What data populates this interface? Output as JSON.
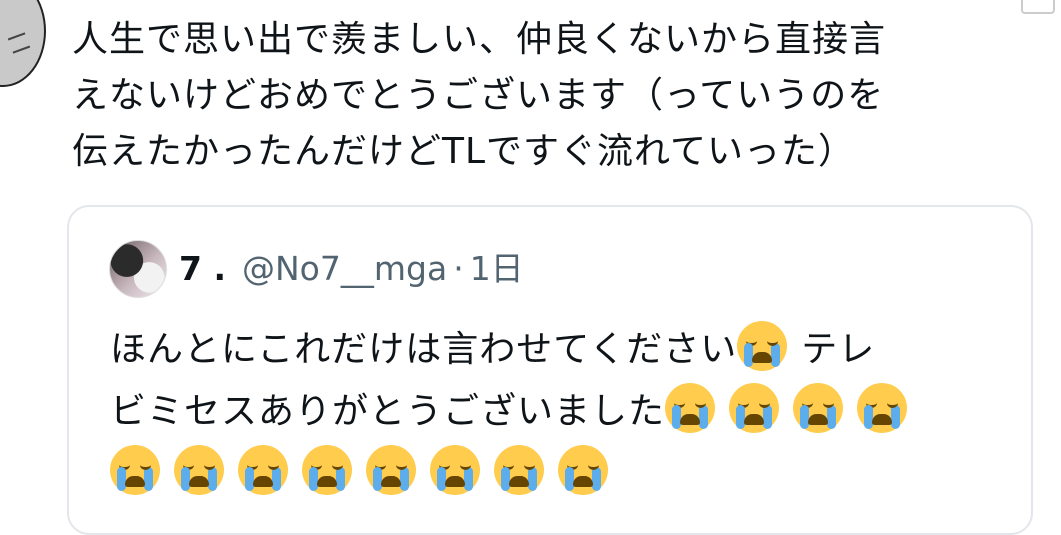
{
  "tweet": {
    "text_lines": [
      "人生で思い出で羨ましい、仲良くないから直接言",
      "えないけどおめでとうございます（っていうのを",
      "伝えたかったんだけどTLですぐ流れていった）"
    ]
  },
  "quoted_tweet": {
    "display_name": "7 .",
    "handle": "@No7__mga",
    "separator": "·",
    "time": "1日",
    "body_line1": "ほんとにこれだけは言わせてください",
    "body_line1_tail": "テレ",
    "body_line2": "ビミセスありがとうございました",
    "emoji_name": "loudly-crying-face",
    "emoji_counts": {
      "line1": 1,
      "line2": 4,
      "line3": 8
    },
    "colors": {
      "emoji_face": "#ffcc4d",
      "tear": "#5dadec",
      "handle": "#536471",
      "border": "#e3e6ea"
    }
  }
}
